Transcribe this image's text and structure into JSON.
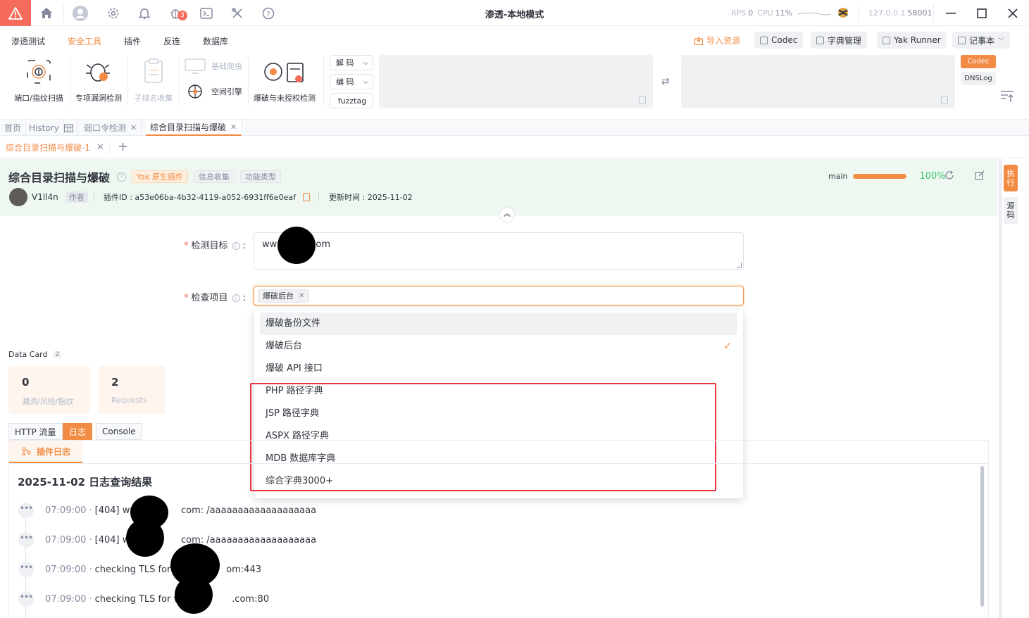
{
  "app": {
    "window_title": "渗透-本地模式",
    "rps_label": "RPS",
    "rps_value": "0",
    "cpu_label": "CPU",
    "cpu_value": "11%",
    "address_ip": "127.0.0.1",
    "address_port": "58001",
    "notification_count": "3",
    "accent_color": "#f28b44"
  },
  "menu": {
    "items": [
      "渗透测试",
      "安全工具",
      "插件",
      "反连",
      "数据库"
    ],
    "active": "安全工具",
    "import_label": "导入资源",
    "codec_label": "Codec",
    "dict_label": "字典管理",
    "runner_label": "Yak Runner",
    "notebook_label": "记事本"
  },
  "tools": {
    "port_scan": "端口/指纹扫描",
    "vuln_scan": "专项漏洞检测",
    "subdomain": "子域名收集",
    "crawler": "基础爬虫",
    "space_engine": "空间引擎",
    "brute": "爆破与未授权检测",
    "decode": "解 码",
    "encode": "编 码",
    "fuzztag": "fuzztag",
    "codec_chip": "Codec",
    "dnslog_chip": "DNSLog"
  },
  "tabs": {
    "home": "首页",
    "history": "History",
    "weak_pwd": "弱口令检测",
    "dir_scan": "综合目录扫描与爆破",
    "sub_tab": "综合目录扫描与爆破-1"
  },
  "plugin": {
    "title": "综合目录扫描与爆破",
    "tag_native": "Yak 原生插件",
    "tag_info": "信息收集",
    "tag_func": "功能类型",
    "author": "V1ll4n",
    "author_badge": "作者",
    "plugin_id": "插件ID : a53e06ba-4b32-4119-a052-6931ff6e0eaf",
    "updated": "更新时间 : 2025-11-02",
    "branch": "main",
    "progress_label": "100%",
    "progress_value": 1.0
  },
  "form": {
    "target_label": "检测目标",
    "target_value_prefix": "ww",
    "target_value_suffix": "com",
    "items_label": "检查项目",
    "selected_tag": "爆破后台"
  },
  "dropdown": {
    "options": [
      "爆破备份文件",
      "爆破后台",
      "爆破 API 接口",
      "PHP 路径字典",
      "JSP 路径字典",
      "ASPX 路径字典",
      "MDB 数据库字典",
      "综合字典3000+"
    ],
    "checked_index": 1,
    "hover_index": 0
  },
  "data_card": {
    "title": "Data Card",
    "count": "2",
    "cards": [
      {
        "value": "0",
        "label": "漏洞/风险/指纹"
      },
      {
        "value": "2",
        "label": "Requests"
      }
    ]
  },
  "bottom": {
    "tabs": [
      "HTTP 流量",
      "日志",
      "Console"
    ],
    "active": "日志",
    "plugin_log_tab": "插件日志",
    "log_heading": "2025-11-02 日志查询结果",
    "logs": [
      {
        "time": "07:09:00 ·",
        "a": "[404] ww",
        "b": "com: /aaaaaaaaaaaaaaaaaaa"
      },
      {
        "time": "07:09:00 ·",
        "a": "[404] ww",
        "b": "com: /aaaaaaaaaaaaaaaaaaa"
      },
      {
        "time": "07:09:00 ·",
        "a": "checking TLS for w",
        "b": "om:443"
      },
      {
        "time": "07:09:00 ·",
        "a": "checking TLS for w",
        "b": ".com:80"
      }
    ]
  },
  "right_rail": {
    "exec": "执行",
    "source": "源码"
  }
}
